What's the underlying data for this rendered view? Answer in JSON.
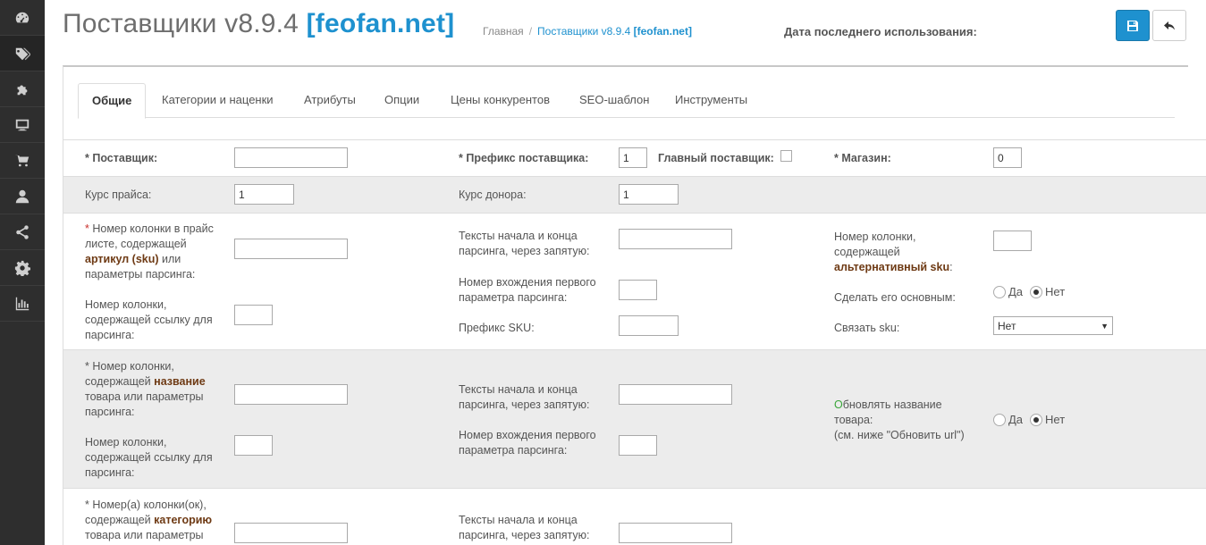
{
  "sidebar": {
    "items": [
      {
        "icon": "dashboard-icon"
      },
      {
        "icon": "tags-icon",
        "active": true
      },
      {
        "icon": "puzzle-icon"
      },
      {
        "icon": "monitor-icon"
      },
      {
        "icon": "cart-icon"
      },
      {
        "icon": "user-icon"
      },
      {
        "icon": "share-icon"
      },
      {
        "icon": "gear-icon"
      },
      {
        "icon": "bar-chart-icon"
      }
    ]
  },
  "header": {
    "title": "Поставщики v8.9.4",
    "title_brand": "[feofan.net]",
    "breadcrumb_home": "Главная",
    "breadcrumb_sep": "/",
    "breadcrumb_current": "Поставщики v8.9.4",
    "breadcrumb_current_brand": "[feofan.net]",
    "last_used_label": "Дата последнего использования:",
    "save_icon": "save-icon",
    "back_icon": "reply-icon",
    "accent": "#1e91cf"
  },
  "tabs": [
    {
      "label": "Общие",
      "active": true
    },
    {
      "label": "Категории и наценки"
    },
    {
      "label": "Атрибуты"
    },
    {
      "label": "Опции"
    },
    {
      "label": "Цены конкурентов"
    },
    {
      "label": "SEO-шаблон"
    },
    {
      "label": "Инструменты"
    }
  ],
  "form": {
    "supplier_label": "* Поставщик:",
    "supplier_value": "",
    "prefix_label": "* Префикс поставщика:",
    "prefix_value": "1",
    "main_supplier_label": "Главный поставщик:",
    "store_label": "* Магазин:",
    "store_value": "0",
    "price_rate_label": "Курс прайса:",
    "price_rate_value": "1",
    "donor_rate_label": "Курс донора:",
    "donor_rate_value": "1",
    "sku": {
      "star": "*",
      "l1": " Номер колонки в прайс",
      "l2": "листе, содержащей",
      "hl": "артикул (sku)",
      "l3": " или",
      "l4": "параметры парсинга:",
      "value": ""
    },
    "link_col": {
      "l1": "Номер колонки,",
      "l2": "содержащей ссылку для",
      "l3": "парсинга:"
    },
    "text_start_end": {
      "l1": "Тексты начала и конца",
      "l2": "парсинга, через запятую:"
    },
    "first_occurrence": {
      "l1": "Номер вхождения первого",
      "l2": "параметра парсинга:"
    },
    "sku_prefix_label": "Префикс SKU:",
    "alt_sku": {
      "l1": "Номер колонки,",
      "l2": "содержащей",
      "hl": "альтернативный sku",
      "tail": ":"
    },
    "make_main_label": "Сделать его основным:",
    "yes": "Да",
    "no": "Нет",
    "link_sku_label": "Связать sku:",
    "link_sku_value": "Нет",
    "name": {
      "l1": "* Номер колонки,",
      "l2a": "содержащей ",
      "hl": "название",
      "l3": "товара или параметры",
      "l4": "парсинга:"
    },
    "update_name": {
      "first": "О",
      "l1rest": "бновлять название",
      "l2": "товара:",
      "l3": "(см. ниже \"Обновить url\")"
    },
    "category": {
      "l1": "* Номер(а) колонки(ок),",
      "l2a": "содержащей ",
      "hl": "категорию",
      "l3": "товара или параметры"
    }
  }
}
